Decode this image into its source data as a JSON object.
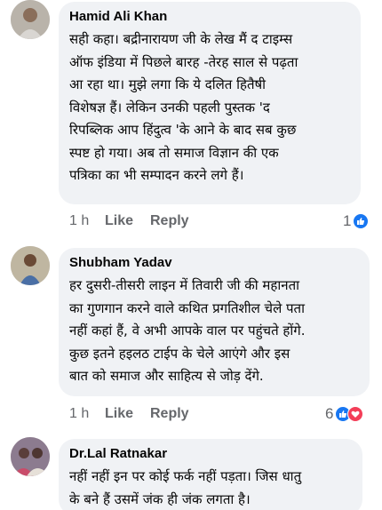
{
  "comments": [
    {
      "author": "Hamid Ali Khan",
      "lines": [
        "सही कहा। बद्रीनारायण  जी के लेख मैं द टाइम्स",
        "ऑफ इंडिया में पिछले बारह -तेरह साल से पढ़ता",
        "आ रहा था। मुझे लगा कि ये दलित हितैषी",
        "विशेषज्ञ हैं। लेकिन उनकी पहली पुस्तक 'द",
        "रिपब्लिक आप हिंदुत्व 'के आने के बाद सब कुछ",
        "स्पष्ट हो गया। अब तो समाज विज्ञान की एक",
        "पत्रिका का भी सम्पादन करने लगे हैं।"
      ],
      "time": "1 h",
      "like": "Like",
      "reply": "Reply",
      "reaction_count": "1",
      "reactions": [
        "like-icon"
      ]
    },
    {
      "author": "Shubham Yadav",
      "lines": [
        "हर दुसरी-तीसरी लाइन में तिवारी जी की महानता",
        "का गुणगान करने वाले कथित प्रगतिशील चेले पता",
        "नहीं कहां हैं, वे अभी आपके वाल पर पहुंचते होंगे.",
        "कुछ इतने हइलठ टाईप के चेले आएंगे और इस",
        "बात को समाज और साहित्य से जोड़ देंगे."
      ],
      "time": "1 h",
      "like": "Like",
      "reply": "Reply",
      "reaction_count": "6",
      "reactions": [
        "like-icon",
        "love-icon"
      ]
    },
    {
      "author": "Dr.Lal Ratnakar",
      "lines": [
        "नहीं नहीं इन पर कोई फर्क नहीं पड़ता। जिस धातु",
        "के बने हैं उसमें जंक ही जंक लगता है।"
      ]
    }
  ],
  "colors": {
    "bubble": "#f0f2f5",
    "meta": "#65676b",
    "like_blue": "#1877f2",
    "love_red": "#f33e58"
  }
}
